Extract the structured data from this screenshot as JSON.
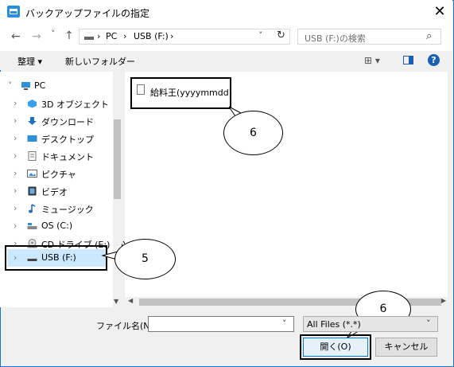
{
  "window": {
    "title": "バックアップファイルの指定",
    "close": "✕"
  },
  "nav": {
    "back": "←",
    "forward": "→",
    "recent": "˅",
    "up": "↑"
  },
  "address": {
    "crumbs": [
      "PC",
      "USB (F:)"
    ],
    "sep": "›"
  },
  "search": {
    "placeholder": "USB (F:)の検索"
  },
  "commands": {
    "organize": "整理 ▾",
    "new_folder": "新しいフォルダー",
    "view": "⊞ ▾",
    "help": "?"
  },
  "tree": {
    "items": [
      {
        "label": "PC",
        "icon": "pc-icon"
      },
      {
        "label": "3D オブジェクト",
        "icon": "cube-icon"
      },
      {
        "label": "ダウンロード",
        "icon": "download-icon"
      },
      {
        "label": "デスクトップ",
        "icon": "desktop-icon"
      },
      {
        "label": "ドキュメント",
        "icon": "document-icon"
      },
      {
        "label": "ピクチャ",
        "icon": "picture-icon"
      },
      {
        "label": "ビデオ",
        "icon": "video-icon"
      },
      {
        "label": "ミュージック",
        "icon": "music-icon"
      },
      {
        "label": "OS (C:)",
        "icon": "drive-icon"
      },
      {
        "label": "CD ドライブ (E:) PAY",
        "icon": "cd-icon"
      },
      {
        "label": "USB (F:)",
        "icon": "usb-icon"
      }
    ]
  },
  "files": [
    {
      "name": "給料王(yyyymmdd)"
    }
  ],
  "callouts": {
    "file": "6",
    "tree": "5",
    "open": "6"
  },
  "footer": {
    "filename_label": "ファイル名(N):",
    "filename_value": "",
    "filter": "All Files (*.*)",
    "open": "開く(O)",
    "cancel": "キャンセル"
  },
  "colors": {
    "accent": "#0078d7",
    "selection": "#cce8ff"
  }
}
